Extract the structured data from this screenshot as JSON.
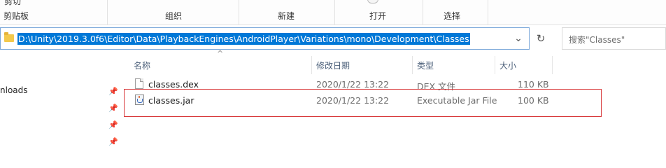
{
  "ribbon": {
    "cut_fragment": "剪切",
    "groups": [
      "剪贴板",
      "组织",
      "新建",
      "打开",
      "选择"
    ]
  },
  "address": {
    "path": "D:\\Unity\\2019.3.0f6\\Editor\\Data\\PlaybackEngines\\AndroidPlayer\\Variations\\mono\\Development\\Classes",
    "dropdown_icon": "chevron-down-icon",
    "refresh_icon": "refresh-icon"
  },
  "search": {
    "placeholder": "搜索\"Classes\""
  },
  "columns": {
    "name": "名称",
    "modified": "修改日期",
    "type": "类型",
    "size": "大小"
  },
  "nav": {
    "item_label": "nloads"
  },
  "files": [
    {
      "name": "classes.dex",
      "modified": "2020/1/22 13:22",
      "type": "DEX 文件",
      "size": "110 KB",
      "icon": "document-icon"
    },
    {
      "name": "classes.jar",
      "modified": "2020/1/22 13:22",
      "type": "Executable Jar File",
      "size": "100 KB",
      "icon": "java-jar-icon"
    }
  ],
  "colors": {
    "selection": "#0078d7",
    "highlight_border": "#d8383a",
    "header_text": "#4c607a"
  }
}
